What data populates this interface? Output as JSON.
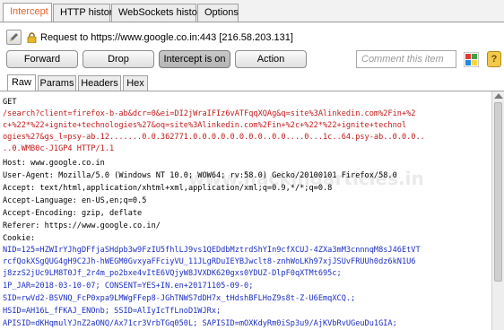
{
  "tabs": [
    "Intercept",
    "HTTP history",
    "WebSockets history",
    "Options"
  ],
  "request_line": "Request to https://www.google.co.in:443  [216.58.203.131]",
  "buttons": {
    "forward": "Forward",
    "drop": "Drop",
    "intercept": "Intercept is on",
    "action": "Action"
  },
  "comment_placeholder": "Comment this item",
  "help_label": "?",
  "subtabs": [
    "Raw",
    "Params",
    "Headers",
    "Hex"
  ],
  "watermark": "www.hackingarticles.in",
  "colors": {
    "active_tab_text": "#e8612c",
    "param_name": "#c21b1b",
    "param_value": "#1c2fc2"
  },
  "request": {
    "l01": "GET",
    "l02": "/search?client=firefox-b-ab&dcr=0&ei=DI2jWraIFIz6vATFqqXQAg&q=site%3Alinkedin.com%2Fin+%2",
    "l03": "c+%22*%22+ignite+technologies%27&oq=site%3Alinkedin.com%2Fin+%2c+%22*%22+ignite+technol",
    "l04": "ogies%27&gs_l=psy-ab.12.......0.0.362771.0.0.0.0.0.0.0.0..0.0....0...1c..64.psy-ab..0.0.0..",
    "l05": "..0.WMB0c-J1GP4 HTTP/1.1",
    "l06": "Host: www.google.co.in",
    "l07": "User-Agent: Mozilla/5.0 (Windows NT 10.0; WOW64; rv:58.0) Gecko/20100101 Firefox/58.0",
    "l08": "Accept: text/html,application/xhtml+xml,application/xml;q=0.9,*/*;q=0.8",
    "l09": "Accept-Language: en-US,en;q=0.5",
    "l10": "Accept-Encoding: gzip, deflate",
    "l11": "Referer: https://www.google.co.in/",
    "l12": "Cookie:",
    "l13": "NID=125=HZWIrYJhgDFfjaSHdpb3w9FzIU5fhlLJ9vs1QEDdbMztrdShYIn9cfXCUJ-4ZXa3mM3cnnnqM8sJ46EtVT",
    "l14": "rcfQokXSgQUG4gH9C2Jh-hWEGM0GvxyaFFciyVU_11JLgRDuIEYBJwclt8-znhWoLKh97xjJSUvFRUUh0dz6kN1U6",
    "l15": "j8zzS2jUc9LM8T0Jf_2r4m_po2bxe4vItE6VQjyW8JVXDK620gxs0YDUZ-DlpF0qXTMt695c;",
    "l16": "1P_JAR=2018-03-10-07; CONSENT=YES+IN.en+20171105-09-0;",
    "l17": "SID=rwVd2-BSVNQ_FcP0xpa9LMWgFFep8-JGhTNWS7dDH7x_tHdshBFLHoZ9s8t-Z-U6EmqXCQ.;",
    "l18": "HSID=AH16L_fFKAJ_ENOnb; SSID=AlIyIcTfLnoD1WJRx;",
    "l19": "APISID=dKHqmulYJnZ2aONQ/Ax71cr3VrbTGq050L; SAPISID=mOXKdyRm0iSp3u9/AjKVbRvUGeuDu1GIA;"
  }
}
